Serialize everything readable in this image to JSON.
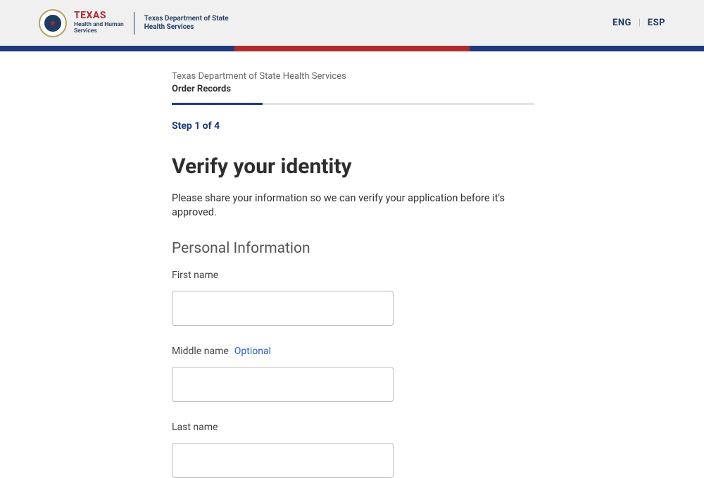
{
  "header": {
    "logo_primary_line1": "TEXAS",
    "logo_primary_line2": "Health and Human",
    "logo_primary_line3": "Services",
    "logo_secondary_line1": "Texas Department of State",
    "logo_secondary_line2": "Health Services",
    "lang_eng": "ENG",
    "lang_esp": "ESP"
  },
  "breadcrumb": {
    "department": "Texas Department of State Health Services",
    "page": "Order Records"
  },
  "form": {
    "step_label": "Step 1 of 4",
    "title": "Verify your identity",
    "description": "Please share your information so we can verify your application before it's approved.",
    "section_title": "Personal Information",
    "fields": {
      "first_name_label": "First name",
      "first_name_value": "",
      "middle_name_label": "Middle name",
      "middle_name_optional": "Optional",
      "middle_name_value": "",
      "last_name_label": "Last name",
      "last_name_value": ""
    }
  }
}
